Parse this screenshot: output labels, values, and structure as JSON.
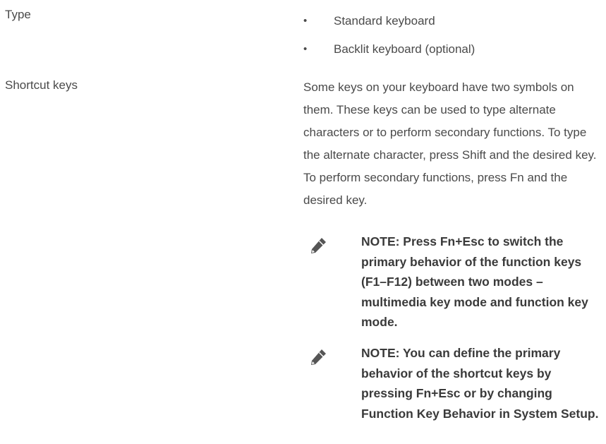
{
  "rows": {
    "type": {
      "label": "Type",
      "items": [
        "Standard keyboard",
        "Backlit keyboard (optional)"
      ]
    },
    "shortcut_keys": {
      "label": "Shortcut keys",
      "description": "Some keys on your keyboard have two symbols on them. These keys can be used to type alternate characters or to perform secondary functions. To type the alternate character, press Shift and the desired key. To perform secondary functions, press Fn and the desired key.",
      "notes": [
        {
          "icon": "note-pencil-icon",
          "text": "NOTE: Press Fn+Esc to switch the primary behavior of the function keys (F1–F12) between two modes – multimedia key mode and function key mode."
        },
        {
          "icon": "note-pencil-icon",
          "text": "NOTE: You can define the primary behavior of the shortcut keys by pressing Fn+Esc or by changing Function Key Behavior in System Setup."
        }
      ]
    }
  },
  "bullet_glyph": "•",
  "colors": {
    "text": "#4a4a4a",
    "note_text": "#3a3a3a",
    "icon": "#555555"
  }
}
